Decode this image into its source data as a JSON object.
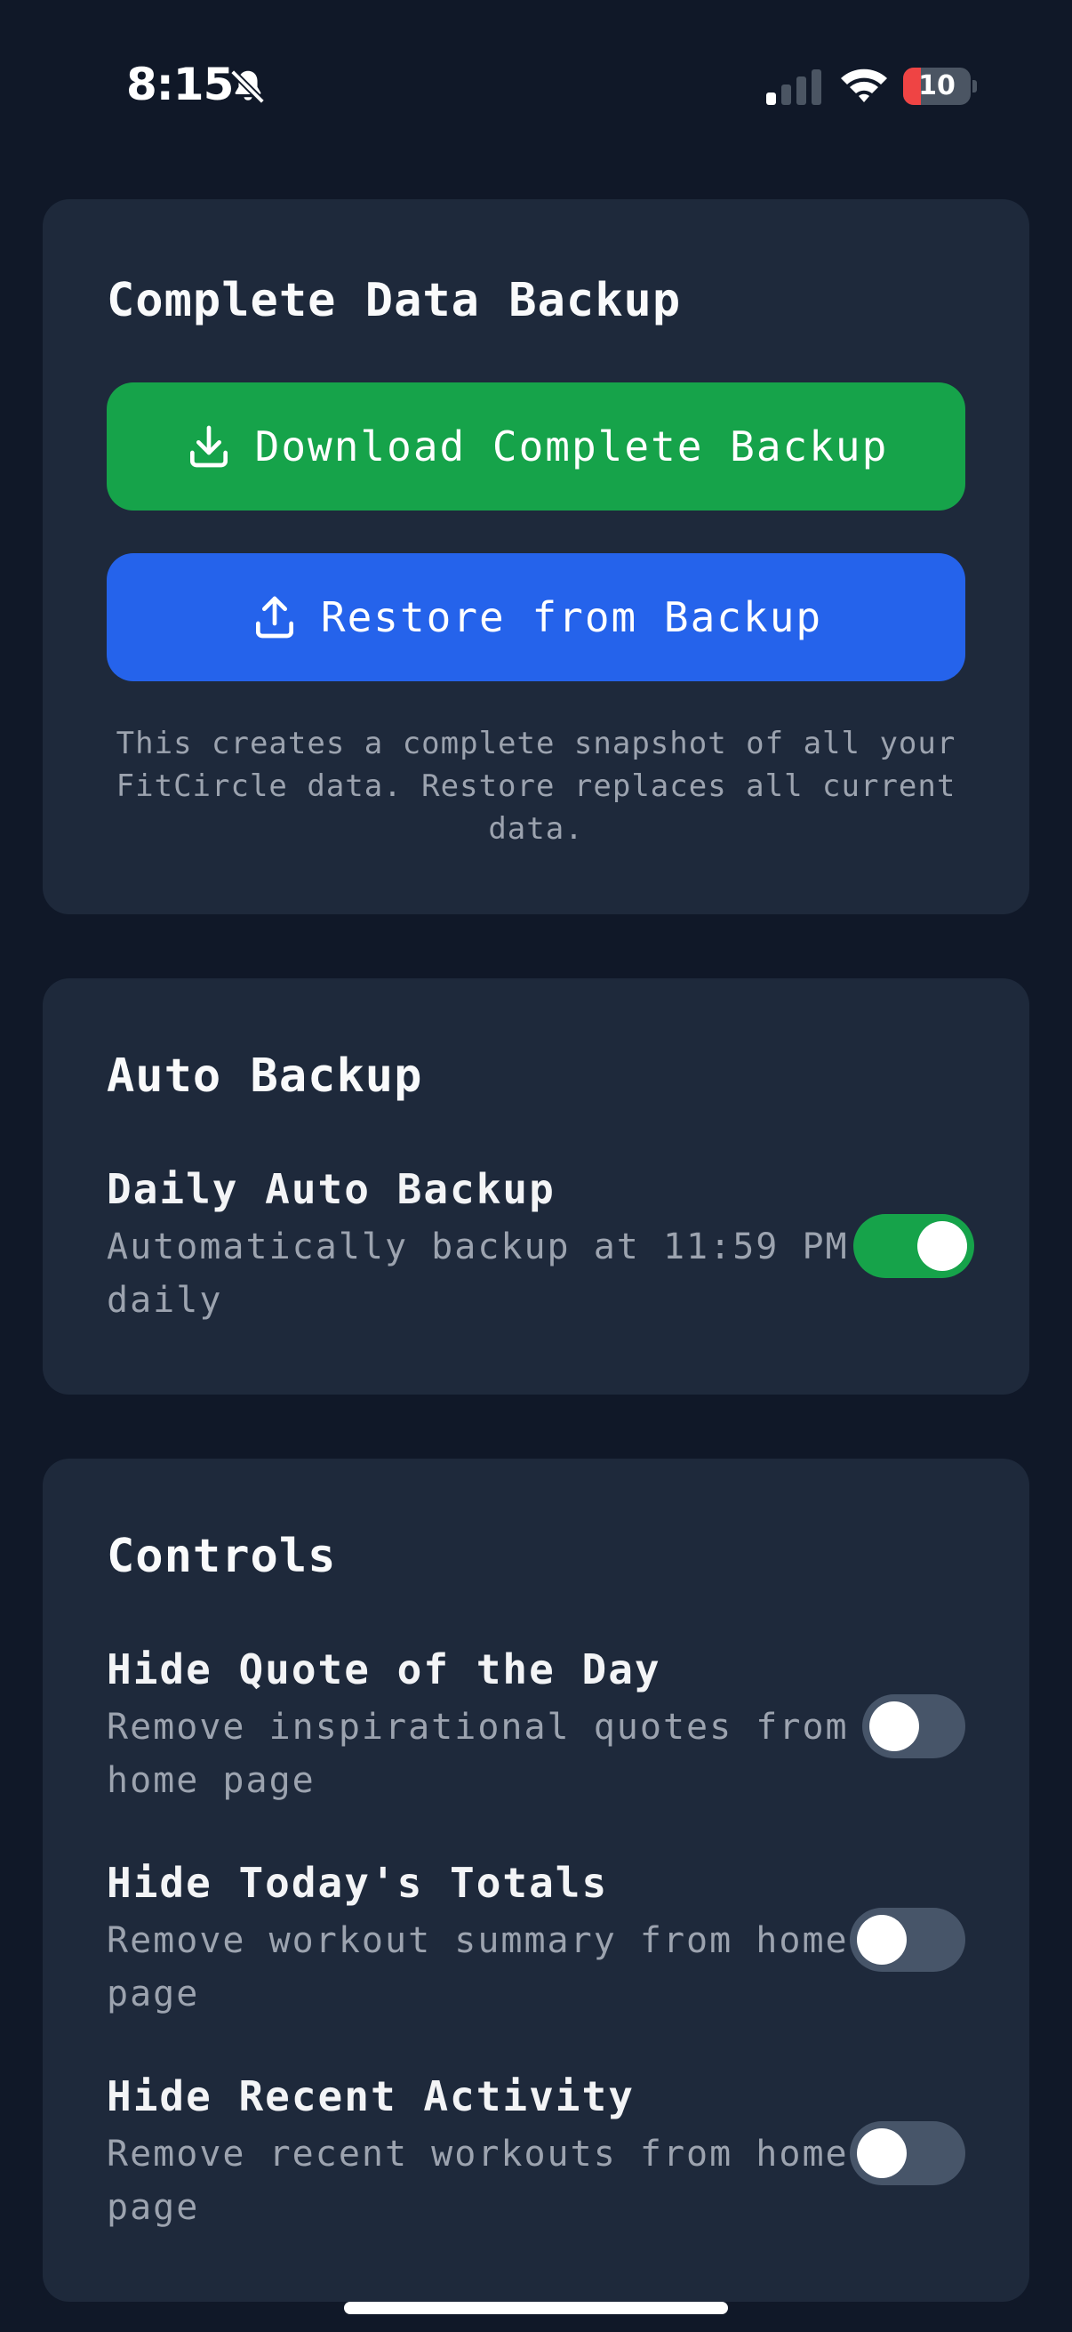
{
  "status_bar": {
    "time": "8:15",
    "battery_level": "10",
    "battery_fraction": 0.1,
    "icons": [
      "bell-slash-icon",
      "cellular-signal-icon",
      "wifi-icon",
      "battery-icon"
    ]
  },
  "backup_card": {
    "title": "Complete Data Backup",
    "download_label": "Download Complete Backup",
    "restore_label": "Restore from Backup",
    "note": "This creates a complete snapshot of all your FitCircle data. Restore replaces all current data."
  },
  "auto_backup_card": {
    "title": "Auto Backup",
    "daily": {
      "title": "Daily Auto Backup",
      "description": "Automatically backup at 11:59 PM daily",
      "enabled": true
    }
  },
  "controls_card": {
    "title": "Controls",
    "items": [
      {
        "title": "Hide Quote of the Day",
        "description": "Remove inspirational quotes from home page",
        "enabled": false
      },
      {
        "title": "Hide Today's Totals",
        "description": "Remove workout summary from home page",
        "enabled": false
      },
      {
        "title": "Hide Recent Activity",
        "description": "Remove recent workouts from home page",
        "enabled": false
      }
    ]
  },
  "colors": {
    "background": "#101828",
    "card": "#1e293b",
    "green": "#16a34a",
    "blue": "#2563eb",
    "toggle_off": "#475569",
    "muted_text": "#9ca3af"
  }
}
